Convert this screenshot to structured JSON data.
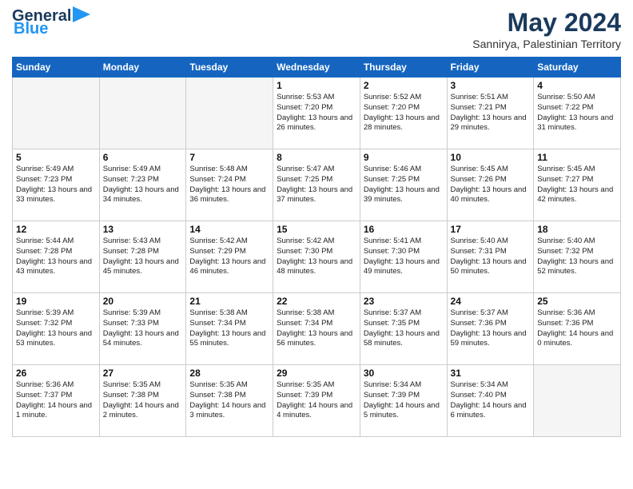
{
  "header": {
    "logo_line1": "General",
    "logo_line2": "Blue",
    "month_year": "May 2024",
    "location": "Sannirya, Palestinian Territory"
  },
  "days_of_week": [
    "Sunday",
    "Monday",
    "Tuesday",
    "Wednesday",
    "Thursday",
    "Friday",
    "Saturday"
  ],
  "weeks": [
    [
      {
        "day": "",
        "empty": true
      },
      {
        "day": "",
        "empty": true
      },
      {
        "day": "",
        "empty": true
      },
      {
        "day": "1",
        "sunrise": "5:53 AM",
        "sunset": "7:20 PM",
        "daylight": "13 hours and 26 minutes."
      },
      {
        "day": "2",
        "sunrise": "5:52 AM",
        "sunset": "7:20 PM",
        "daylight": "13 hours and 28 minutes."
      },
      {
        "day": "3",
        "sunrise": "5:51 AM",
        "sunset": "7:21 PM",
        "daylight": "13 hours and 29 minutes."
      },
      {
        "day": "4",
        "sunrise": "5:50 AM",
        "sunset": "7:22 PM",
        "daylight": "13 hours and 31 minutes."
      }
    ],
    [
      {
        "day": "5",
        "sunrise": "5:49 AM",
        "sunset": "7:23 PM",
        "daylight": "13 hours and 33 minutes."
      },
      {
        "day": "6",
        "sunrise": "5:49 AM",
        "sunset": "7:23 PM",
        "daylight": "13 hours and 34 minutes."
      },
      {
        "day": "7",
        "sunrise": "5:48 AM",
        "sunset": "7:24 PM",
        "daylight": "13 hours and 36 minutes."
      },
      {
        "day": "8",
        "sunrise": "5:47 AM",
        "sunset": "7:25 PM",
        "daylight": "13 hours and 37 minutes."
      },
      {
        "day": "9",
        "sunrise": "5:46 AM",
        "sunset": "7:25 PM",
        "daylight": "13 hours and 39 minutes."
      },
      {
        "day": "10",
        "sunrise": "5:45 AM",
        "sunset": "7:26 PM",
        "daylight": "13 hours and 40 minutes."
      },
      {
        "day": "11",
        "sunrise": "5:45 AM",
        "sunset": "7:27 PM",
        "daylight": "13 hours and 42 minutes."
      }
    ],
    [
      {
        "day": "12",
        "sunrise": "5:44 AM",
        "sunset": "7:28 PM",
        "daylight": "13 hours and 43 minutes."
      },
      {
        "day": "13",
        "sunrise": "5:43 AM",
        "sunset": "7:28 PM",
        "daylight": "13 hours and 45 minutes."
      },
      {
        "day": "14",
        "sunrise": "5:42 AM",
        "sunset": "7:29 PM",
        "daylight": "13 hours and 46 minutes."
      },
      {
        "day": "15",
        "sunrise": "5:42 AM",
        "sunset": "7:30 PM",
        "daylight": "13 hours and 48 minutes."
      },
      {
        "day": "16",
        "sunrise": "5:41 AM",
        "sunset": "7:30 PM",
        "daylight": "13 hours and 49 minutes."
      },
      {
        "day": "17",
        "sunrise": "5:40 AM",
        "sunset": "7:31 PM",
        "daylight": "13 hours and 50 minutes."
      },
      {
        "day": "18",
        "sunrise": "5:40 AM",
        "sunset": "7:32 PM",
        "daylight": "13 hours and 52 minutes."
      }
    ],
    [
      {
        "day": "19",
        "sunrise": "5:39 AM",
        "sunset": "7:32 PM",
        "daylight": "13 hours and 53 minutes."
      },
      {
        "day": "20",
        "sunrise": "5:39 AM",
        "sunset": "7:33 PM",
        "daylight": "13 hours and 54 minutes."
      },
      {
        "day": "21",
        "sunrise": "5:38 AM",
        "sunset": "7:34 PM",
        "daylight": "13 hours and 55 minutes."
      },
      {
        "day": "22",
        "sunrise": "5:38 AM",
        "sunset": "7:34 PM",
        "daylight": "13 hours and 56 minutes."
      },
      {
        "day": "23",
        "sunrise": "5:37 AM",
        "sunset": "7:35 PM",
        "daylight": "13 hours and 58 minutes."
      },
      {
        "day": "24",
        "sunrise": "5:37 AM",
        "sunset": "7:36 PM",
        "daylight": "13 hours and 59 minutes."
      },
      {
        "day": "25",
        "sunrise": "5:36 AM",
        "sunset": "7:36 PM",
        "daylight": "14 hours and 0 minutes."
      }
    ],
    [
      {
        "day": "26",
        "sunrise": "5:36 AM",
        "sunset": "7:37 PM",
        "daylight": "14 hours and 1 minute."
      },
      {
        "day": "27",
        "sunrise": "5:35 AM",
        "sunset": "7:38 PM",
        "daylight": "14 hours and 2 minutes."
      },
      {
        "day": "28",
        "sunrise": "5:35 AM",
        "sunset": "7:38 PM",
        "daylight": "14 hours and 3 minutes."
      },
      {
        "day": "29",
        "sunrise": "5:35 AM",
        "sunset": "7:39 PM",
        "daylight": "14 hours and 4 minutes."
      },
      {
        "day": "30",
        "sunrise": "5:34 AM",
        "sunset": "7:39 PM",
        "daylight": "14 hours and 5 minutes."
      },
      {
        "day": "31",
        "sunrise": "5:34 AM",
        "sunset": "7:40 PM",
        "daylight": "14 hours and 6 minutes."
      },
      {
        "day": "",
        "empty": true
      }
    ]
  ]
}
